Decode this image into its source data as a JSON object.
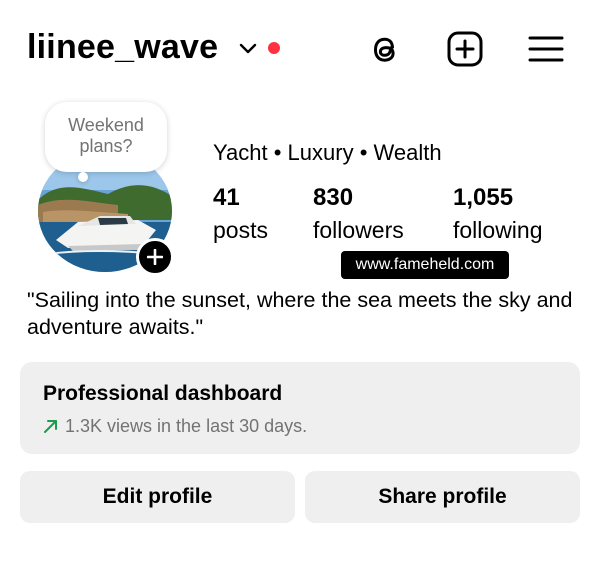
{
  "header": {
    "username": "liinee_wave",
    "icons": [
      "chevron-down-icon",
      "notification-dot",
      "threads-icon",
      "create-plus-icon",
      "menu-icon"
    ],
    "dot_color": "#ff3040"
  },
  "note": {
    "line1": "Weekend",
    "line2": "plans?"
  },
  "profile": {
    "category": "Yacht • Luxury • Wealth",
    "stats": [
      {
        "value": "41",
        "label": "posts"
      },
      {
        "value": "830",
        "label": "followers"
      },
      {
        "value": "1,055",
        "label": "following"
      }
    ],
    "bio": "\"Sailing into the sunset, where the sea meets the sky and adventure awaits.\""
  },
  "watermark": "www.fameheld.com",
  "dashboard": {
    "title": "Professional dashboard",
    "subtitle": "1.3K views in the last 30 days.",
    "trend_color": "#1a9e4b"
  },
  "actions": {
    "edit_label": "Edit profile",
    "share_label": "Share profile"
  }
}
